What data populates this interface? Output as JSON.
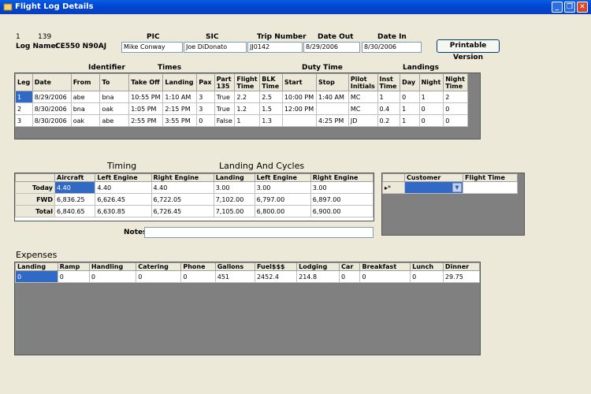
{
  "window": {
    "title": "Flight Log Details"
  },
  "header": {
    "row_id_a": "1",
    "row_id_b": "139",
    "log_name_label": "Log Name:",
    "log_name_value": "CE550 N90AJ",
    "pic_label": "PIC",
    "pic_value": "Mike Conway",
    "sic_label": "SIC",
    "sic_value": "Joe DiDonato",
    "trip_label": "Trip Number",
    "trip_value": "JJ0142",
    "date_out_label": "Date Out",
    "date_out_value": "8/29/2006",
    "date_in_label": "Date In",
    "date_in_value": "8/30/2006",
    "print_button": "Printable Version"
  },
  "legs": {
    "group_identifier": "Identifier",
    "group_times": "Times",
    "group_duty": "Duty Time",
    "group_landings": "Landings",
    "columns": [
      "Leg",
      "Date",
      "From",
      "To",
      "Take Off",
      "Landing",
      "Pax",
      "Part 135",
      "Flight Time",
      "BLK Time",
      "Start",
      "Stop",
      "Pilot Initials",
      "Inst Time",
      "Day",
      "Night",
      "Night Time"
    ],
    "rows": [
      [
        "1",
        "8/29/2006",
        "abe",
        "bna",
        "10:55 PM",
        "1:10 AM",
        "3",
        "True",
        "2.2",
        "2.5",
        "10:00 PM",
        "1:40 AM",
        "MC",
        "1",
        "0",
        "1",
        "2"
      ],
      [
        "2",
        "8/30/2006",
        "bna",
        "oak",
        "1:05 PM",
        "2:15 PM",
        "3",
        "True",
        "1.2",
        "1.5",
        "12:00 PM",
        "",
        "MC",
        "0.4",
        "1",
        "0",
        "0"
      ],
      [
        "3",
        "8/30/2006",
        "oak",
        "abe",
        "2:55 PM",
        "3:55 PM",
        "0",
        "False",
        "1",
        "1.3",
        "",
        "4:25 PM",
        "JD",
        "0.2",
        "1",
        "0",
        "0"
      ]
    ]
  },
  "timing": {
    "title_timing": "Timing",
    "title_landing": "Landing And Cycles",
    "columns": [
      "Aircraft",
      "Left Engine",
      "Right Engine",
      "Landing",
      "Left Engine",
      "Right Engine"
    ],
    "rows": [
      {
        "label": "Today",
        "values": [
          "4.40",
          "4.40",
          "4.40",
          "3.00",
          "3.00",
          "3.00"
        ]
      },
      {
        "label": "FWD",
        "values": [
          "6,836.25",
          "6,626.45",
          "6,722.05",
          "7,102.00",
          "6,797.00",
          "6,897.00"
        ]
      },
      {
        "label": "Total",
        "values": [
          "6,840.65",
          "6,630.85",
          "6,726.45",
          "7,105.00",
          "6,800.00",
          "6,900.00"
        ]
      }
    ],
    "notes_label": "Notes"
  },
  "customers": {
    "columns": [
      "Customer",
      "Flight Time"
    ],
    "new_row_marker": "▸*",
    "customer_value": "",
    "flight_time_value": ""
  },
  "expenses": {
    "title": "Expenses",
    "columns": [
      "Landing",
      "Ramp",
      "Handling",
      "Catering",
      "Phone",
      "Gallons",
      "Fuel$$$",
      "Lodging",
      "Car",
      "Breakfast",
      "Lunch",
      "Dinner"
    ],
    "rows": [
      [
        "0",
        "0",
        "0",
        "0",
        "0",
        "451",
        "2452.4",
        "214.8",
        "0",
        "0",
        "0",
        "29.75"
      ]
    ]
  }
}
